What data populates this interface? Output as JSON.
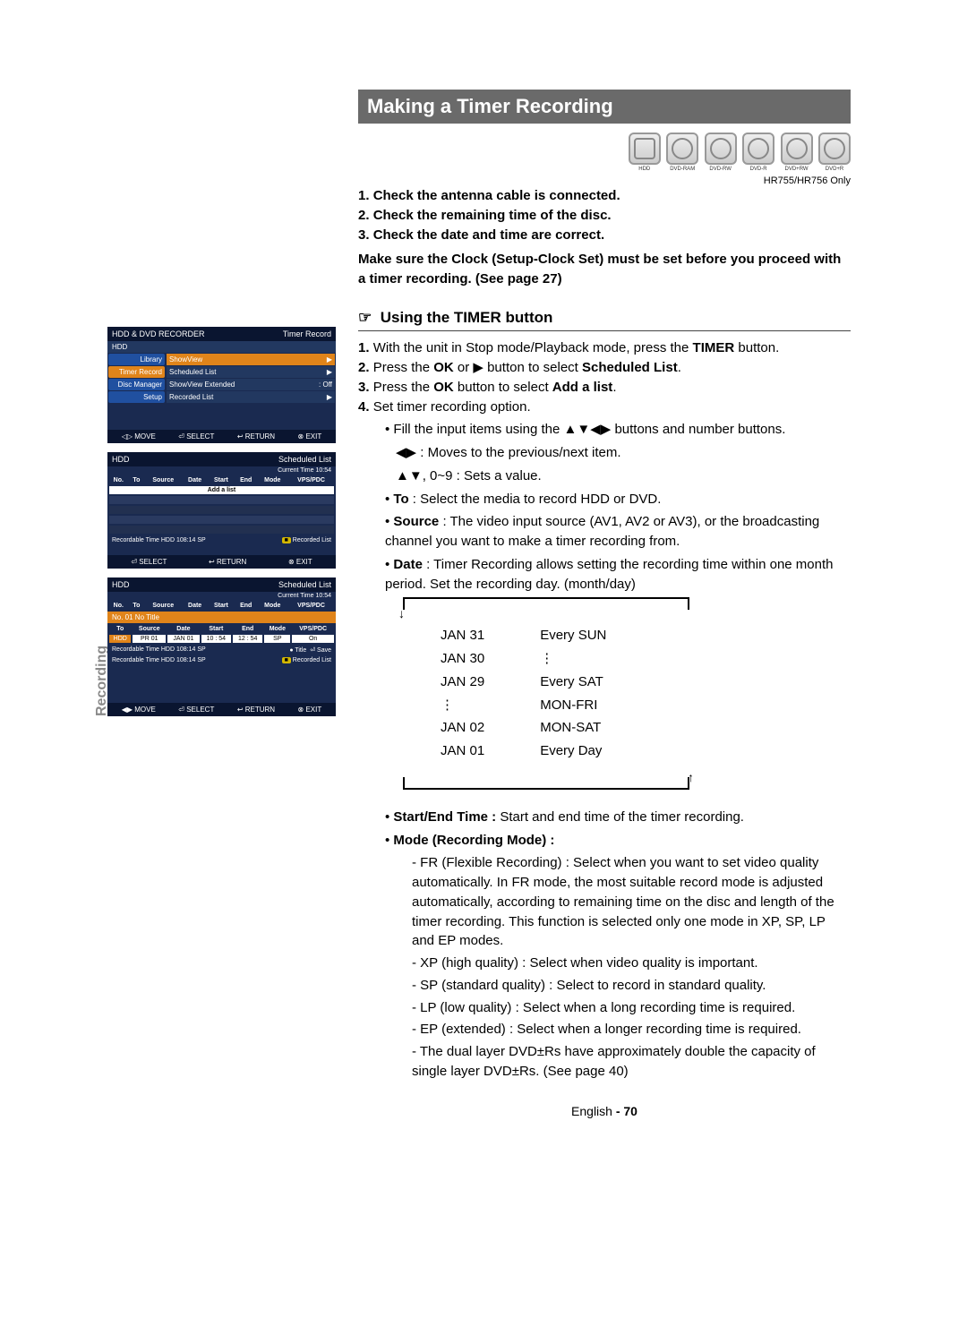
{
  "side_tab": "Recording",
  "title": "Making a Timer Recording",
  "disc_note": "HR755/HR756 Only",
  "disc_labels": [
    "HDD",
    "DVD-RAM",
    "DVD-RW",
    "DVD-R",
    "DVD+RW",
    "DVD+R"
  ],
  "checks": {
    "c1": "Check the antenna cable is connected.",
    "c2": "Check the remaining time of the disc.",
    "c3": "Check the date and time are correct."
  },
  "clock_note": "Make sure the Clock (Setup-Clock Set) must be set before you proceed with a timer recording. (See page 27)",
  "section_timer": "Using the TIMER button",
  "steps": {
    "s1a": "With the unit in Stop mode/Playback mode, press the ",
    "s1b": "TIMER",
    "s1c": " button.",
    "s2a": "Press the ",
    "s2b": "OK",
    "s2c": " or ▶ button to select ",
    "s2d": "Scheduled List",
    "s2e": ".",
    "s3a": "Press the ",
    "s3b": "OK",
    "s3c": " button to select ",
    "s3d": "Add a list",
    "s3e": ".",
    "s4": "Set timer recording option."
  },
  "opts": {
    "fill": "Fill the input items using the ▲▼◀▶ buttons and number buttons.",
    "move": "◀▶ : Moves to the previous/next item.",
    "sets": "▲▼, 0~9 : Sets a value.",
    "to_lbl": "To",
    "to_txt": " : Select the media to record HDD or DVD.",
    "src_lbl": "Source",
    "src_txt": " : The video input source (AV1, AV2 or AV3), or the broadcasting channel you want to make a timer recording from.",
    "date_lbl": "Date",
    "date_txt": " : Timer Recording allows setting the recording time within one month period. Set the recording day. (month/day)"
  },
  "date_cycle": {
    "left": [
      "JAN 31",
      "JAN 30",
      "JAN 29",
      "⋮",
      "JAN 02",
      "JAN 01"
    ],
    "right": [
      "Every SUN",
      "⋮",
      "Every SAT",
      "MON-FRI",
      "MON-SAT",
      "Every Day"
    ]
  },
  "after_table": {
    "se_lbl": "Start/End Time :",
    "se_txt": " Start and end time of the timer recording.",
    "mode_lbl": "Mode (Recording Mode) :",
    "fr": "- FR (Flexible Recording) : Select when you want to set video quality automatically. In FR mode, the most suitable record mode is adjusted automatically, according to remaining time on the disc and length of the timer recording. This function is selected only one mode in XP, SP, LP and EP modes.",
    "xp": "- XP (high quality) : Select when video quality is important.",
    "sp": "- SP (standard quality) : Select to record in standard quality.",
    "lp": "- LP (low quality) : Select when a long recording time is required.",
    "ep": "- EP (extended) : Select when a longer recording time is required.",
    "dual": "- The dual layer DVD±Rs have approximately double the capacity of single layer DVD±Rs. (See page 40)"
  },
  "footer_lang": "English",
  "footer_page": "- 70",
  "osd1": {
    "title": "HDD & DVD RECORDER",
    "mode": "Timer Record",
    "tab": "HDD",
    "left": [
      "Library",
      "Timer Record",
      "Disc Manager",
      "Setup"
    ],
    "right": [
      {
        "l": "ShowView",
        "r": "▶"
      },
      {
        "l": "Scheduled List",
        "r": "▶"
      },
      {
        "l": "ShowView Extended",
        "r": ": Off"
      },
      {
        "l": "Recorded List",
        "r": "▶"
      }
    ],
    "foot": [
      "◁▷ MOVE",
      "⏎ SELECT",
      "↩ RETURN",
      "⊗ EXIT"
    ]
  },
  "osd2": {
    "tab": "HDD",
    "mode": "Scheduled List",
    "time": "Current Time 10:54",
    "headers": [
      "No.",
      "To",
      "Source",
      "Date",
      "Start",
      "End",
      "Mode",
      "VPS/PDC"
    ],
    "addlist": "Add a list",
    "rec": "Recordable Time  HDD  108:14 SP",
    "reclist": "Recorded List",
    "foot": [
      "⏎ SELECT",
      "↩ RETURN",
      "⊗ EXIT"
    ]
  },
  "osd3": {
    "tab": "HDD",
    "mode": "Scheduled List",
    "time": "Current Time 10:54",
    "headers": [
      "No.",
      "To",
      "Source",
      "Date",
      "Start",
      "End",
      "Mode",
      "VPS/PDC"
    ],
    "notitle": "No. 01 No Title",
    "headers2": [
      "To",
      "Source",
      "Date",
      "Start",
      "End",
      "Mode",
      "VPS/PDC"
    ],
    "editrow": [
      "HDD",
      "PR 01",
      "JAN 01",
      "10 : 54",
      "12 : 54",
      "SP",
      "On"
    ],
    "rec1": "Recordable Time  HDD  108:14 SP",
    "title_btn": "Title",
    "save_btn": "Save",
    "rec2": "Recordable Time  HDD  108:14 SP",
    "reclist": "Recorded List",
    "foot": [
      "◀▶ MOVE",
      "⏎ SELECT",
      "↩ RETURN",
      "⊗ EXIT"
    ]
  }
}
